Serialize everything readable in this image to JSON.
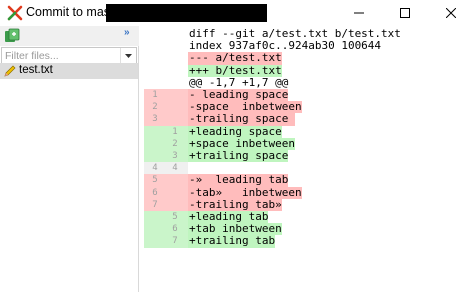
{
  "window": {
    "title": "Commit to master",
    "icons": {
      "app": "git-extensions-icon",
      "minimize": "minimize-icon",
      "maximize": "maximize-icon",
      "close": "close-icon"
    }
  },
  "left_panel": {
    "toolbar_chevron": "»",
    "filter": {
      "placeholder": "Filter files...",
      "value": ""
    },
    "files": [
      {
        "name": "test.txt",
        "icon": "modified-file-icon"
      }
    ]
  },
  "diff": {
    "lines": [
      {
        "kind": "header",
        "a": "",
        "b": "",
        "text": "diff --git a/test.txt b/test.txt"
      },
      {
        "kind": "header",
        "a": "",
        "b": "",
        "text": "index 937af0c..924ab30 100644"
      },
      {
        "kind": "header-del",
        "a": "",
        "b": "",
        "text": "--- a/test.txt"
      },
      {
        "kind": "header-add",
        "a": "",
        "b": "",
        "text": "+++ b/test.txt"
      },
      {
        "kind": "hunk",
        "a": "",
        "b": "",
        "text": "@@ -1,7 +1,7 @@"
      },
      {
        "kind": "del",
        "a": "1",
        "b": "",
        "text": "- leading space"
      },
      {
        "kind": "del",
        "a": "2",
        "b": "",
        "text": "-space  inbetween"
      },
      {
        "kind": "del",
        "a": "3",
        "b": "",
        "text": "-trailing space "
      },
      {
        "kind": "add",
        "a": "",
        "b": "1",
        "text": "+leading space"
      },
      {
        "kind": "add",
        "a": "",
        "b": "2",
        "text": "+space inbetween"
      },
      {
        "kind": "add",
        "a": "",
        "b": "3",
        "text": "+trailing space"
      },
      {
        "kind": "ctx",
        "a": "4",
        "b": "4",
        "text": " "
      },
      {
        "kind": "del",
        "a": "5",
        "b": "",
        "text": "-»  leading tab"
      },
      {
        "kind": "del",
        "a": "6",
        "b": "",
        "text": "-tab»   inbetween"
      },
      {
        "kind": "del",
        "a": "7",
        "b": "",
        "text": "-trailing tab»"
      },
      {
        "kind": "add",
        "a": "",
        "b": "5",
        "text": "+leading tab"
      },
      {
        "kind": "add",
        "a": "",
        "b": "6",
        "text": "+tab inbetween"
      },
      {
        "kind": "add",
        "a": "",
        "b": "7",
        "text": "+trailing tab"
      }
    ]
  },
  "colors": {
    "deleted_bg": "#ffcaca",
    "added_bg": "#caf5ca",
    "deleted_highlight": "#ffbcbc",
    "added_highlight": "#bff5bf"
  }
}
